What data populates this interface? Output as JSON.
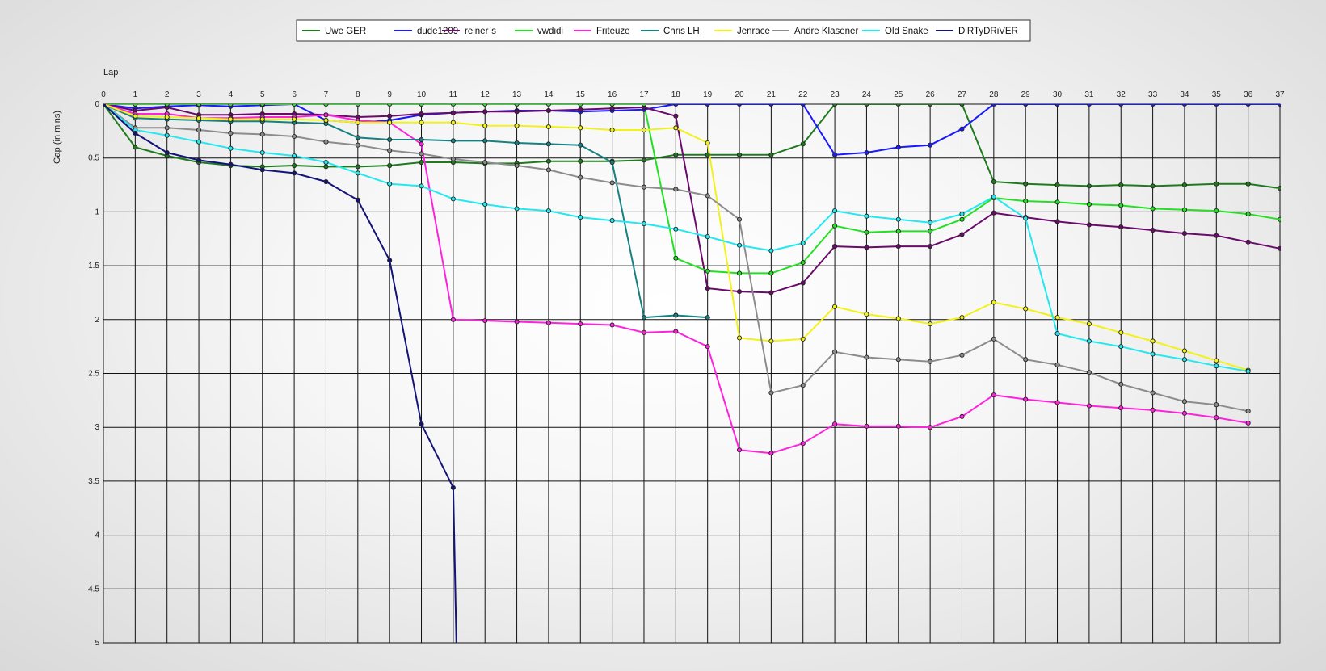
{
  "chart_data": {
    "type": "line",
    "title": "",
    "xlabel": "Lap",
    "ylabel": "Gap (in mins)",
    "x": [
      0,
      1,
      2,
      3,
      4,
      5,
      6,
      7,
      8,
      9,
      10,
      11,
      12,
      13,
      14,
      15,
      16,
      17,
      18,
      19,
      20,
      21,
      22,
      23,
      24,
      25,
      26,
      27,
      28,
      29,
      30,
      31,
      32,
      33,
      34,
      35,
      36,
      37
    ],
    "xlim": [
      0,
      37
    ],
    "ylim": [
      0,
      5
    ],
    "y_inverted": true,
    "y_ticks": [
      "0",
      "0.5",
      "1",
      "1.5",
      "2",
      "2.5",
      "3",
      "3.5",
      "4",
      "4.5",
      "5"
    ],
    "x_ticks": [
      "0",
      "1",
      "2",
      "3",
      "4",
      "5",
      "6",
      "7",
      "8",
      "9",
      "10",
      "11",
      "12",
      "13",
      "14",
      "15",
      "16",
      "17",
      "18",
      "19",
      "20",
      "21",
      "22",
      "23",
      "24",
      "25",
      "26",
      "27",
      "28",
      "29",
      "30",
      "31",
      "32",
      "33",
      "34",
      "35",
      "36",
      "37"
    ],
    "grid": true,
    "legend_position": "top-center",
    "series": [
      {
        "name": "Uwe GER",
        "color": "#1f7a1f",
        "values": [
          0,
          0.4,
          0.48,
          0.54,
          0.57,
          0.58,
          0.57,
          0.58,
          0.58,
          0.57,
          0.54,
          0.54,
          0.55,
          0.55,
          0.53,
          0.53,
          0.53,
          0.52,
          0.47,
          0.47,
          0.47,
          0.47,
          0.37,
          0,
          0,
          0,
          0,
          0,
          0.72,
          0.74,
          0.75,
          0.76,
          0.75,
          0.76,
          0.75,
          0.74,
          0.74,
          0.78
        ]
      },
      {
        "name": "dude1209",
        "color": "#1a1aff",
        "values": [
          0,
          0.04,
          0.02,
          0.01,
          0.02,
          0.01,
          0,
          0.15,
          0.17,
          0.15,
          0.1,
          0.08,
          0.07,
          0.06,
          0.06,
          0.07,
          0.06,
          0.05,
          0,
          0,
          0,
          0,
          0,
          0.47,
          0.45,
          0.4,
          0.38,
          0.23,
          0,
          0,
          0,
          0,
          0,
          0,
          0,
          0,
          0,
          0
        ]
      },
      {
        "name": "reiner`s",
        "color": "#6a0a6a",
        "values": [
          0,
          0.06,
          0.03,
          0.1,
          0.1,
          0.09,
          0.09,
          0.1,
          0.12,
          0.11,
          0.09,
          0.08,
          0.07,
          0.07,
          0.06,
          0.05,
          0.04,
          0.03,
          0.11,
          1.71,
          1.74,
          1.75,
          1.66,
          1.32,
          1.33,
          1.32,
          1.32,
          1.21,
          1.01,
          1.05,
          1.09,
          1.12,
          1.14,
          1.17,
          1.2,
          1.22,
          1.28,
          1.34
        ]
      },
      {
        "name": "vwdidi",
        "color": "#22e022",
        "values": [
          0,
          0,
          0,
          0,
          0,
          0,
          0,
          0,
          0,
          0,
          0,
          0,
          0,
          0,
          0,
          0,
          0,
          0,
          1.43,
          1.55,
          1.57,
          1.57,
          1.47,
          1.13,
          1.19,
          1.18,
          1.18,
          1.07,
          0.87,
          0.9,
          0.91,
          0.93,
          0.94,
          0.97,
          0.98,
          0.99,
          1.02,
          1.07
        ]
      },
      {
        "name": "Friteuze",
        "color": "#ff22dd",
        "values": [
          0,
          0.09,
          0.09,
          0.13,
          0.13,
          0.12,
          0.12,
          0.1,
          0.15,
          0.17,
          0.37,
          2,
          2.01,
          2.02,
          2.03,
          2.04,
          2.05,
          2.12,
          2.11,
          2.25,
          3.21,
          3.24,
          3.15,
          2.97,
          2.99,
          2.99,
          3,
          2.9,
          2.7,
          2.74,
          2.77,
          2.8,
          2.82,
          2.84,
          2.87,
          2.91,
          2.96,
          null
        ]
      },
      {
        "name": "Chris LH",
        "color": "#178080",
        "values": [
          0,
          0.13,
          0.14,
          0.15,
          0.16,
          0.16,
          0.17,
          0.18,
          0.31,
          0.33,
          0.33,
          0.34,
          0.34,
          0.36,
          0.37,
          0.38,
          0.54,
          1.98,
          1.96,
          1.98,
          null,
          null,
          null,
          null,
          null,
          null,
          null,
          null,
          null,
          null,
          null,
          null,
          null,
          null,
          null,
          null,
          null,
          null
        ]
      },
      {
        "name": "Jenrace",
        "color": "#f2f21a",
        "values": [
          0,
          0.11,
          0.12,
          0.13,
          0.14,
          0.14,
          0.14,
          0.15,
          0.17,
          0.17,
          0.17,
          0.17,
          0.2,
          0.2,
          0.21,
          0.22,
          0.24,
          0.24,
          0.22,
          0.36,
          2.17,
          2.2,
          2.18,
          1.88,
          1.95,
          1.99,
          2.04,
          1.98,
          1.84,
          1.9,
          1.98,
          2.04,
          2.12,
          2.2,
          2.29,
          2.38,
          2.47,
          null
        ]
      },
      {
        "name": "Andre Klasener",
        "color": "#8c8c8c",
        "values": [
          0,
          0.22,
          0.22,
          0.24,
          0.27,
          0.28,
          0.3,
          0.35,
          0.38,
          0.43,
          0.46,
          0.51,
          0.54,
          0.57,
          0.61,
          0.68,
          0.73,
          0.77,
          0.79,
          0.85,
          1.07,
          2.68,
          2.61,
          2.3,
          2.35,
          2.37,
          2.39,
          2.33,
          2.18,
          2.37,
          2.42,
          2.49,
          2.6,
          2.68,
          2.76,
          2.79,
          2.85,
          null
        ]
      },
      {
        "name": "Old Snake",
        "color": "#22e8f0",
        "values": [
          0,
          0.24,
          0.29,
          0.35,
          0.41,
          0.45,
          0.48,
          0.54,
          0.64,
          0.74,
          0.76,
          0.88,
          0.93,
          0.97,
          0.99,
          1.05,
          1.08,
          1.11,
          1.16,
          1.23,
          1.31,
          1.36,
          1.29,
          0.99,
          1.04,
          1.07,
          1.1,
          1.02,
          0.86,
          1.06,
          2.13,
          2.2,
          2.25,
          2.32,
          2.37,
          2.43,
          2.48,
          null
        ]
      },
      {
        "name": "DiRTyDRiVER",
        "color": "#141478",
        "values": [
          0,
          0.27,
          0.45,
          0.52,
          0.56,
          0.61,
          0.64,
          0.72,
          0.89,
          1.45,
          2.97,
          3.56,
          5,
          null,
          null,
          null,
          null,
          null,
          null,
          null,
          null,
          null,
          null,
          null,
          null,
          null,
          null,
          null,
          null,
          null,
          null,
          null,
          null,
          null,
          null,
          null,
          null,
          null
        ],
        "x_overrides": {
          "12": 11.1
        }
      }
    ]
  }
}
